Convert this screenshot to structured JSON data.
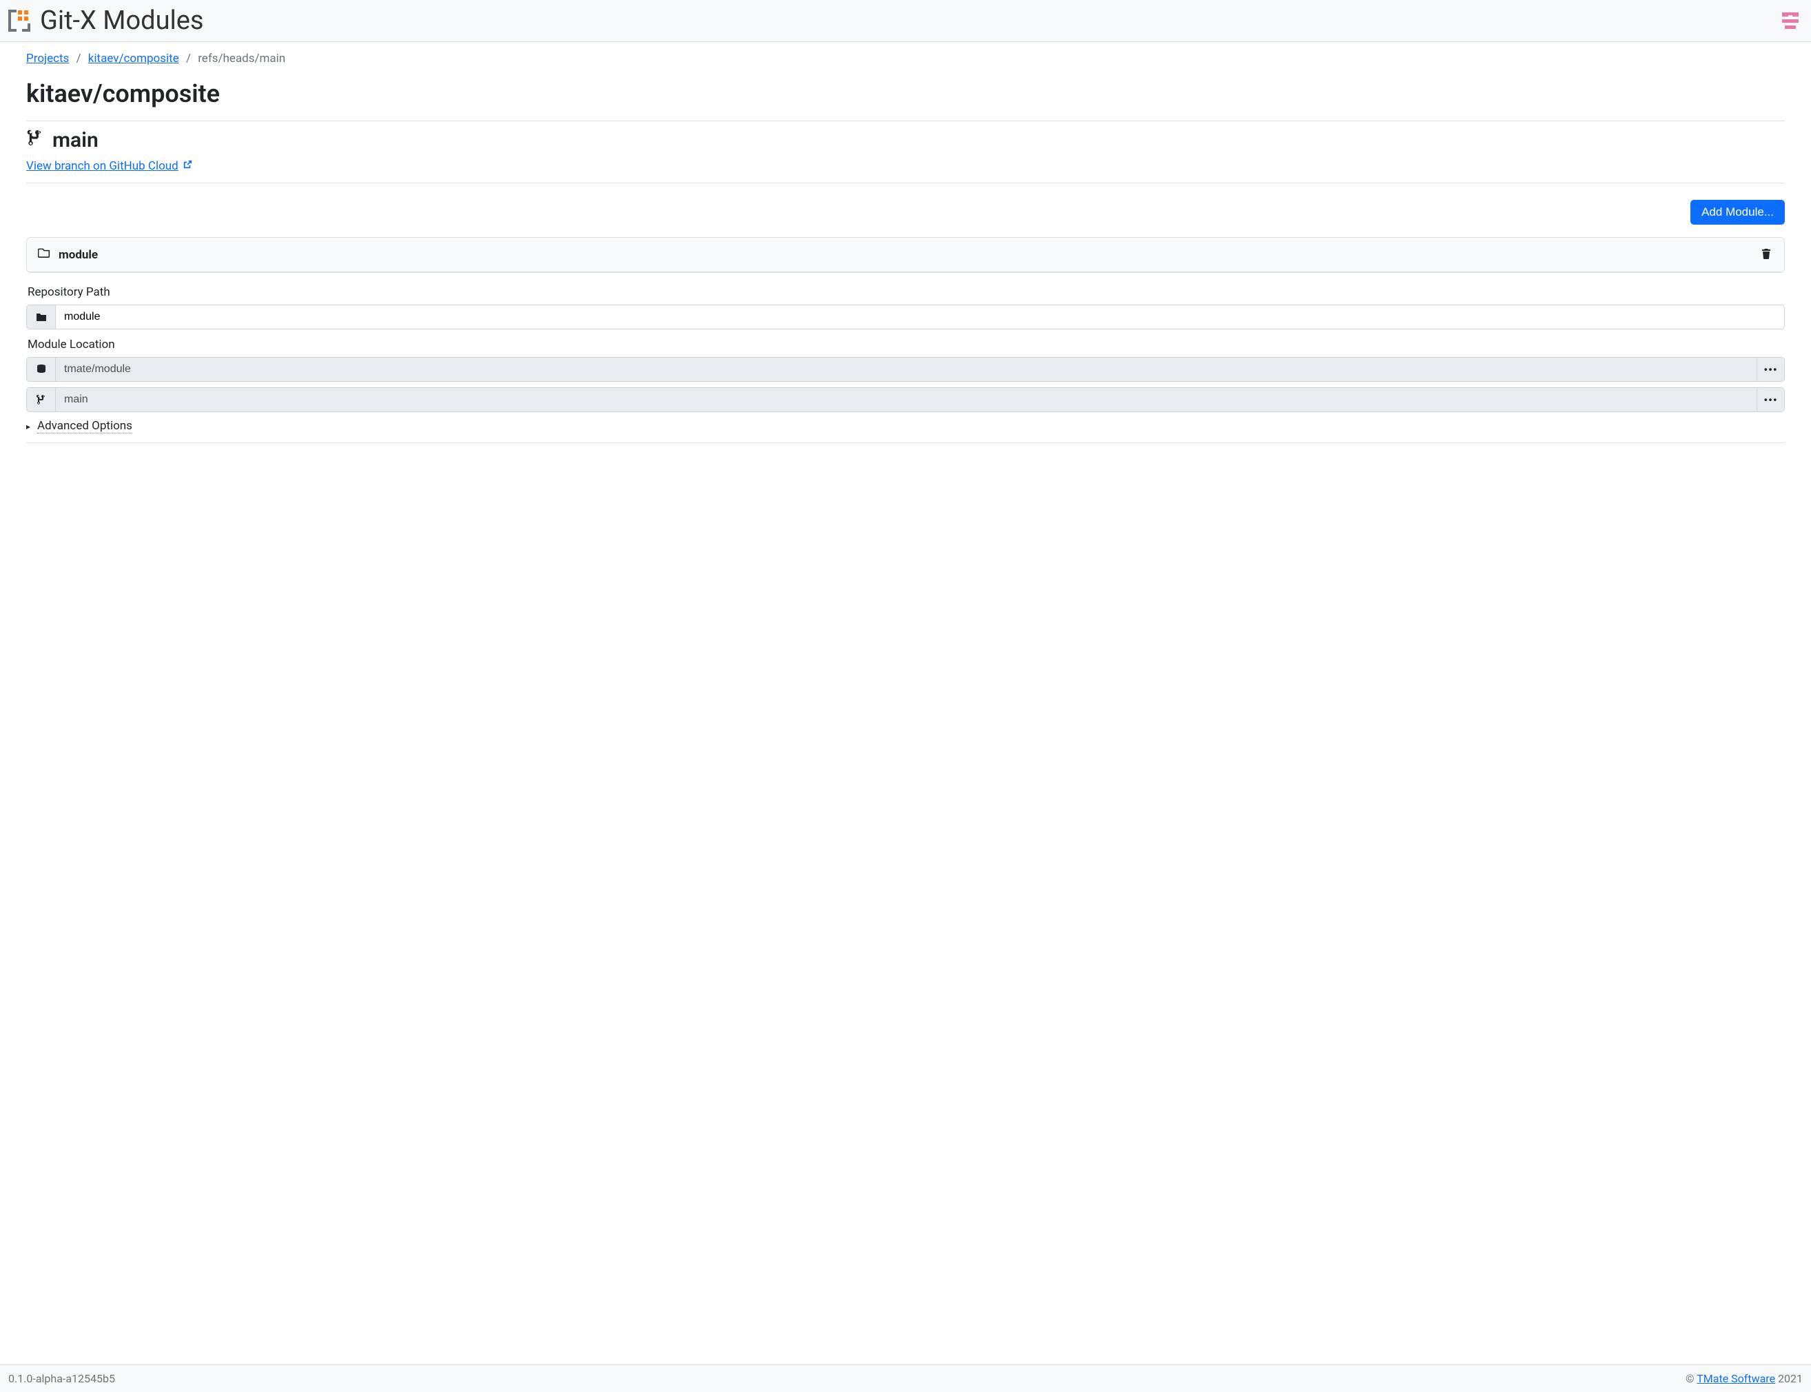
{
  "header": {
    "app_title": "Git-X Modules"
  },
  "breadcrumb": {
    "items": [
      {
        "label": "Projects",
        "href": true
      },
      {
        "label": "kitaev/composite",
        "href": true
      },
      {
        "label": "refs/heads/main",
        "href": false
      }
    ]
  },
  "page": {
    "title": "kitaev/composite",
    "branch_name": "main",
    "view_link_text": "View branch on GitHub Cloud"
  },
  "toolbar": {
    "add_module_label": "Add Module..."
  },
  "module": {
    "name": "module",
    "repo_path_label": "Repository Path",
    "repo_path_value": "module",
    "location_label": "Module Location",
    "location_repo_value": "tmate/module",
    "location_branch_value": "main",
    "advanced_label": "Advanced Options"
  },
  "footer": {
    "version": "0.1.0-alpha-a12545b5",
    "copyright_prefix": "© ",
    "company": "TMate Software",
    "year": " 2021"
  }
}
